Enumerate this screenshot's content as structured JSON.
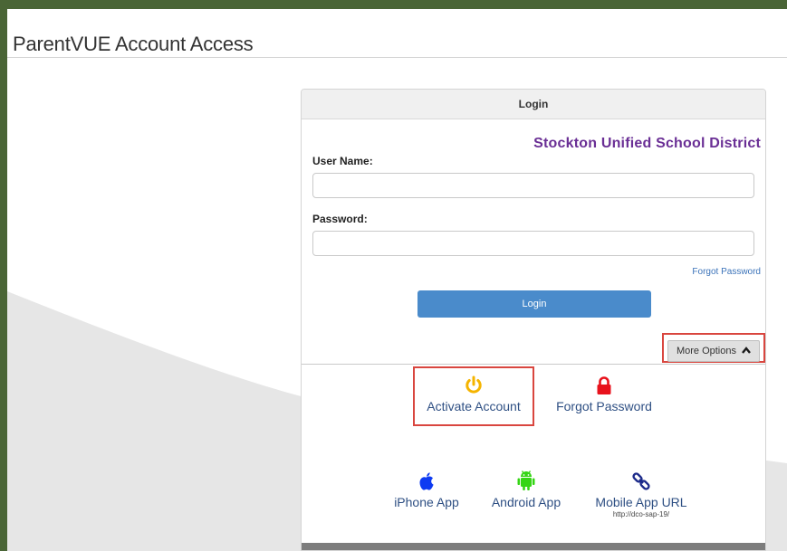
{
  "page": {
    "title": "ParentVUE Account Access"
  },
  "login_panel": {
    "header": "Login",
    "district": "Stockton Unified School District",
    "username_label": "User Name:",
    "username_value": "",
    "password_label": "Password:",
    "password_value": "",
    "forgot_password_link": "Forgot Password",
    "login_button": "Login",
    "more_options_button": "More Options"
  },
  "more_options": {
    "activate_account": {
      "label": "Activate Account",
      "icon": "power-icon",
      "color": "#f5b400"
    },
    "forgot_password": {
      "label": "Forgot Password",
      "icon": "lock-icon",
      "color": "#e8121c"
    },
    "iphone_app": {
      "label": "iPhone App",
      "icon": "apple-icon",
      "color": "#0e3bf2"
    },
    "android_app": {
      "label": "Android App",
      "icon": "android-icon",
      "color": "#35d515"
    },
    "mobile_app_url": {
      "label": "Mobile App URL",
      "url": "http://dco-sap-19/",
      "icon": "link-icon",
      "color": "#1c2a8a"
    }
  },
  "colors": {
    "frame_border": "#4a6536",
    "district_text": "#6a2f95",
    "login_button_bg": "#4a8bcb",
    "highlight_box": "#d9463f",
    "link": "#3b73b9"
  }
}
